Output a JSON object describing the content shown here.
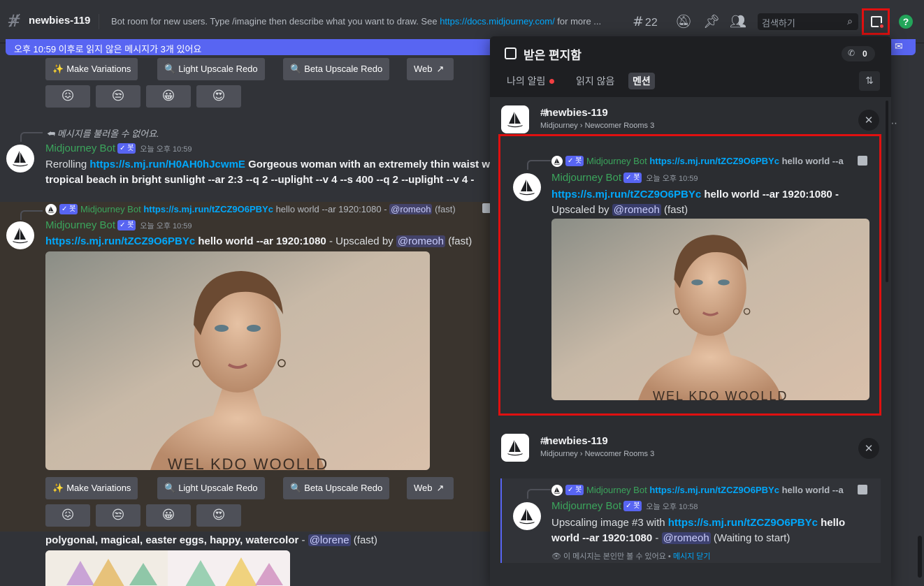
{
  "topbar": {
    "channel_name": "newbies-119",
    "topic_prefix": "Bot room for new users. Type /imagine then describe what you want to draw. See ",
    "topic_link": "https://docs.midjourney.com/",
    "topic_suffix": " for more ...",
    "threads_count": "22",
    "search_placeholder": "검색하기"
  },
  "unread_banner": "오후 10:59 이후로 읽지 않은 메시지가 3개 있어요",
  "buttons": {
    "make_variations": "Make Variations",
    "light_upscale": "Light Upscale Redo",
    "beta_upscale": "Beta Upscale Redo",
    "web": "Web"
  },
  "reactions": [
    "😖",
    "😒",
    "😀",
    "😍"
  ],
  "chat": {
    "msg1": {
      "reply_text": "메시지를 불러올 수 없어요.",
      "author": "Midjourney Bot",
      "badge": "✓ 봇",
      "time": "오늘 오후 10:59",
      "prefix": "Rerolling ",
      "link": "https://s.mj.run/H0AH0hJcwmE",
      "text_line1": " Gorgeous woman with an extremely thin waist w",
      "text_line2": "tropical beach in bright sunlight --ar 2:3 --q 2 --uplight --v 4 --s 400 --q 2 --uplight --v 4 -"
    },
    "msg2": {
      "reply_author": "Midjourney Bot",
      "reply_badge": "✓ 봇",
      "reply_link": "https://s.mj.run/tZCZ9O6PBYc",
      "reply_text": " hello world --ar 1920:1080 - ",
      "reply_mention": "@romeoh",
      "reply_suffix": " (fast)",
      "author": "Midjourney Bot",
      "badge": "✓ 봇",
      "time": "오늘 오후 10:59",
      "link": "https://s.mj.run/tZCZ9O6PBYc",
      "text": " hello world --ar 1920:1080",
      "upscaled_by": " - Upscaled by ",
      "mention": "@romeoh",
      "speed": " (fast)",
      "image_caption": "WEL KDO WOOLLD"
    },
    "msg3": {
      "text": "polygonal, magical, easter eggs, happy, watercolor",
      "dash": " - ",
      "mention": "@lorene",
      "speed": " (fast)"
    }
  },
  "inbox": {
    "title": "받은 편지함",
    "count": "0",
    "tabs": [
      "나의 알림",
      "읽지 않음",
      "멘션"
    ],
    "items": [
      {
        "channel": "newbies-119",
        "path": "Midjourney › Newcomer Rooms 3",
        "reply_author": "Midjourney Bot",
        "reply_badge": "✓ 봇",
        "reply_link": "https://s.mj.run/tZCZ9O6PBYc",
        "reply_text": " hello world --a",
        "author": "Midjourney Bot",
        "badge": "✓ 봇",
        "time": "오늘 오후 10:59",
        "link": "https://s.mj.run/tZCZ9O6PBYc",
        "text": " hello world --ar 1920:1080 -",
        "upscaled_by": "Upscaled by ",
        "mention": "@romeoh",
        "speed": " (fast)",
        "image_caption": "WEL KDO WOOLLD"
      },
      {
        "channel": "newbies-119",
        "path": "Midjourney › Newcomer Rooms 3",
        "reply_author": "Midjourney Bot",
        "reply_badge": "✓ 봇",
        "reply_link": "https://s.mj.run/tZCZ9O6PBYc",
        "reply_text": " hello world --a",
        "author": "Midjourney Bot",
        "badge": "✓ 봇",
        "time": "오늘 오후 10:58",
        "prefix": "Upscaling image #3 with ",
        "link": "https://s.mj.run/tZCZ9O6PBYc",
        "text_a": " hello",
        "text_b": "world --ar 1920:1080",
        "dash": " - ",
        "mention": "@romeoh",
        "status": " (Waiting to start)",
        "ephemeral": "이 메시지는 본인만 볼 수 있어요 • ",
        "dismiss": "메시지 닫기"
      }
    ]
  },
  "colors": {
    "accent": "#5865f2",
    "bot_green": "#3ba55c",
    "link": "#00a8fc",
    "highlight_red": "#e01010"
  }
}
